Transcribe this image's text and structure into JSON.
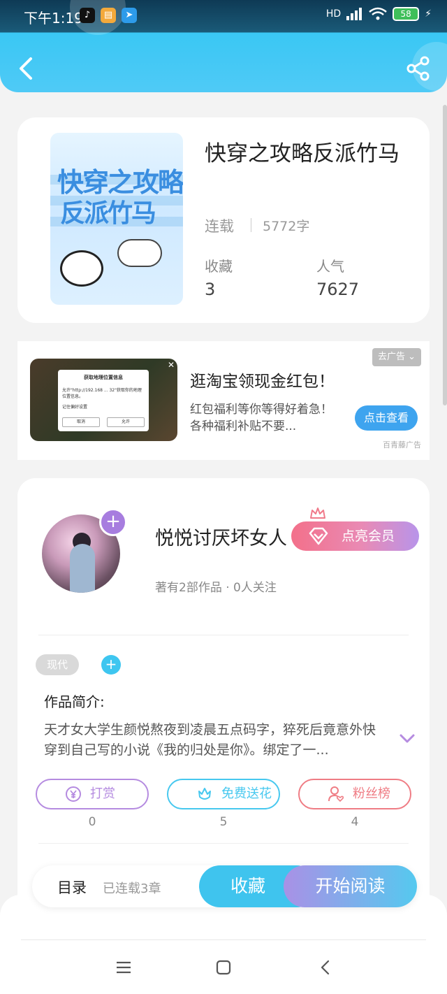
{
  "status_bar": {
    "time": "下午1:19",
    "network": "HD",
    "battery": "58"
  },
  "book": {
    "title": "快穿之攻略反派竹马",
    "cover_title_line1": "快穿之攻略",
    "cover_title_line2": "反派竹马",
    "status": "连载",
    "word_count": "5772字",
    "favorites_label": "收藏",
    "favorites_value": "3",
    "popularity_label": "人气",
    "popularity_value": "7627"
  },
  "ad": {
    "title": "逛淘宝领现金红包！",
    "description": "红包福利等你等得好着急！各种福利补贴不要...",
    "remove_label": "去广告",
    "button_label": "点击查看",
    "source": "百青藤广告",
    "dialog_title": "获取地理位置信息",
    "dialog_text": "允许\"http://192.168 ... 32\"获取你的地理位置信息。",
    "dialog_remember": "记住偏好设置",
    "dialog_cancel": "取消",
    "dialog_allow": "允许"
  },
  "author": {
    "name": "悦悦讨厌坏女人",
    "meta": "著有2部作品 · 0人关注",
    "vip_button": "点亮会员"
  },
  "tags": [
    "现代"
  ],
  "intro": {
    "heading": "作品简介:",
    "text": "天才女大学生颜悦熬夜到凌晨五点码字，猝死后竟意外快穿到自己写的小说《我的归处是你》。绑定了一..."
  },
  "actions": [
    {
      "label": "打赏",
      "count": "0",
      "color": "#b58be0"
    },
    {
      "label": "免费送花",
      "count": "5",
      "color": "#47c8ef"
    },
    {
      "label": "粉丝榜",
      "count": "4",
      "color": "#ef7c84"
    }
  ],
  "bottom_bar": {
    "menu_label": "目录",
    "chapter_count": "已连载3章",
    "favorite_label": "收藏",
    "read_label": "开始阅读"
  },
  "colors": {
    "header": "#3ac7f4",
    "accent_blue": "#3fc4ee",
    "accent_purple": "#a77ddf"
  }
}
